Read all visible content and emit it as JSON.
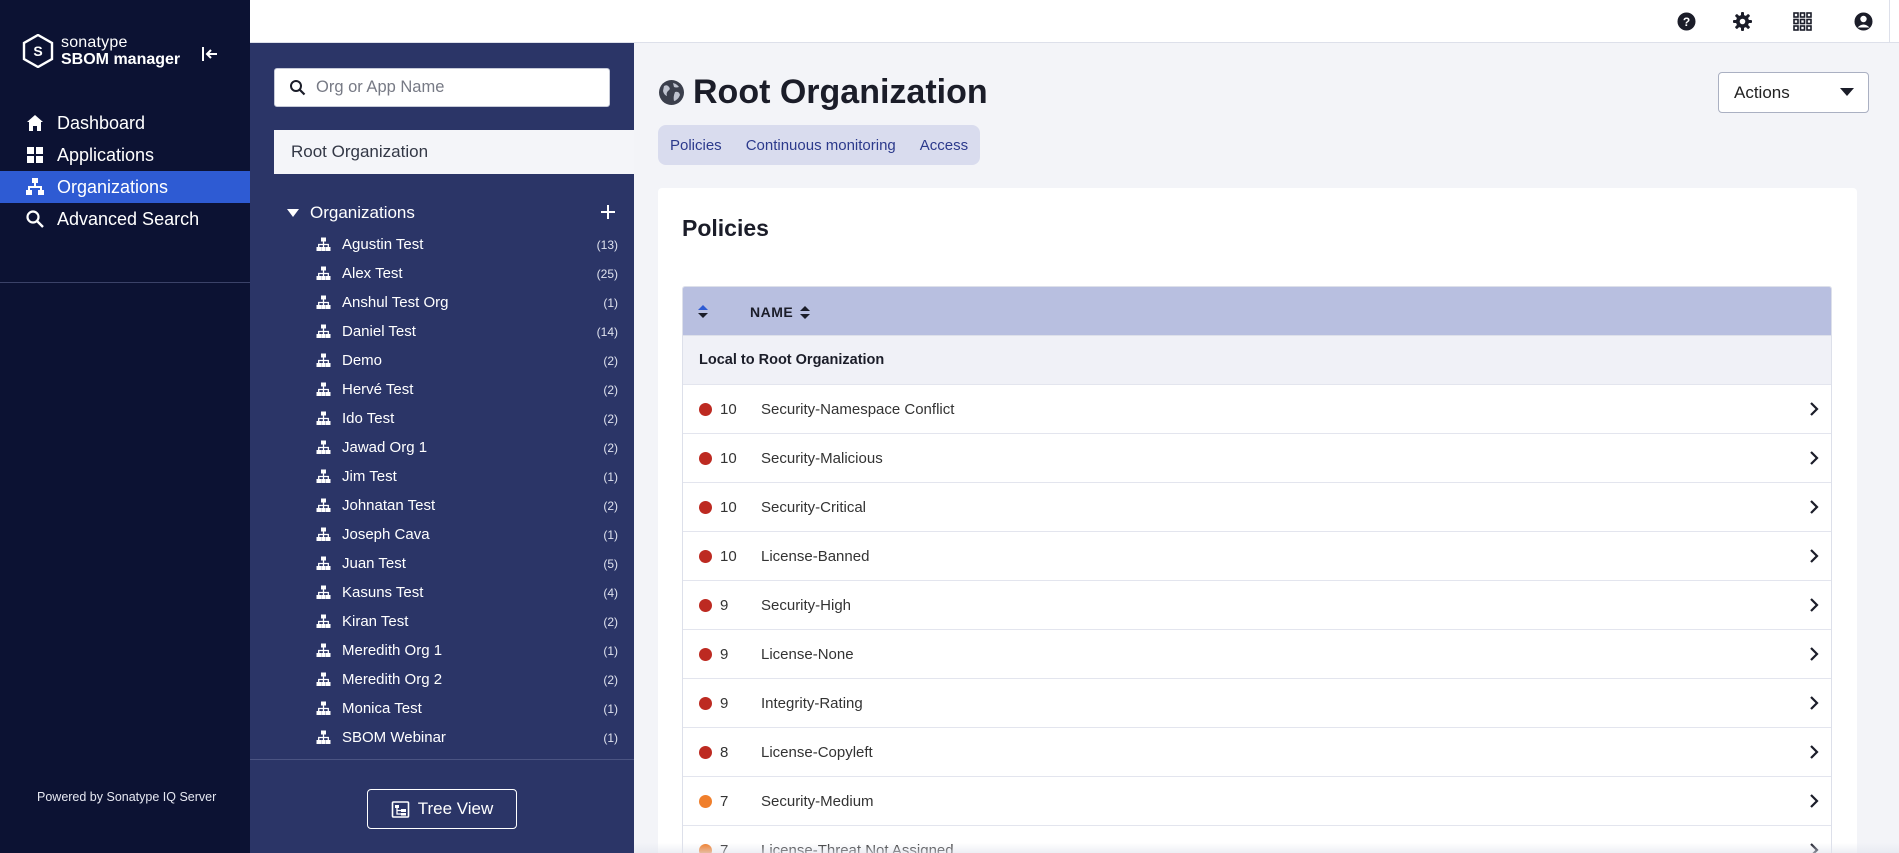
{
  "brand": {
    "line1": "sonatype",
    "line2": "SBOM manager"
  },
  "nav": {
    "items": [
      {
        "label": "Dashboard",
        "icon": "home-icon"
      },
      {
        "label": "Applications",
        "icon": "grid-icon"
      },
      {
        "label": "Organizations",
        "icon": "org-tree-icon",
        "active": true
      },
      {
        "label": "Advanced Search",
        "icon": "search-icon"
      }
    ],
    "powered_by": "Powered by Sonatype IQ Server"
  },
  "topbar": {
    "icons": [
      "help-icon",
      "gear-icon",
      "apps-grid-icon",
      "user-icon"
    ]
  },
  "orgpanel": {
    "search_placeholder": "Org or App Name",
    "root_label": "Root Organization",
    "section_label": "Organizations",
    "orgs": [
      {
        "name": "Agustin Test",
        "count": "(13)"
      },
      {
        "name": "Alex Test",
        "count": "(25)"
      },
      {
        "name": "Anshul Test Org",
        "count": "(1)"
      },
      {
        "name": "Daniel Test",
        "count": "(14)"
      },
      {
        "name": "Demo",
        "count": "(2)"
      },
      {
        "name": "Hervé Test",
        "count": "(2)"
      },
      {
        "name": "Ido Test",
        "count": "(2)"
      },
      {
        "name": "Jawad Org 1",
        "count": "(2)"
      },
      {
        "name": "Jim Test",
        "count": "(1)"
      },
      {
        "name": "Johnatan Test",
        "count": "(2)"
      },
      {
        "name": "Joseph Cava",
        "count": "(1)"
      },
      {
        "name": "Juan Test",
        "count": "(5)"
      },
      {
        "name": "Kasuns Test",
        "count": "(4)"
      },
      {
        "name": "Kiran Test",
        "count": "(2)"
      },
      {
        "name": "Meredith Org 1",
        "count": "(1)"
      },
      {
        "name": "Meredith Org 2",
        "count": "(2)"
      },
      {
        "name": "Monica Test",
        "count": "(1)"
      },
      {
        "name": "SBOM Webinar",
        "count": "(1)"
      }
    ],
    "tree_view_label": "Tree View"
  },
  "main": {
    "title": "Root Organization",
    "actions_label": "Actions",
    "tabs": [
      "Policies",
      "Continuous monitoring",
      "Access"
    ],
    "card_title": "Policies",
    "table": {
      "name_header": "NAME",
      "group_label": "Local to Root Organization",
      "rows": [
        {
          "threat": "10",
          "name": "Security-Namespace Conflict",
          "color": "#bd2a21"
        },
        {
          "threat": "10",
          "name": "Security-Malicious",
          "color": "#bd2a21"
        },
        {
          "threat": "10",
          "name": "Security-Critical",
          "color": "#bd2a21"
        },
        {
          "threat": "10",
          "name": "License-Banned",
          "color": "#bd2a21"
        },
        {
          "threat": "9",
          "name": "Security-High",
          "color": "#bd2a21"
        },
        {
          "threat": "9",
          "name": "License-None",
          "color": "#bd2a21"
        },
        {
          "threat": "9",
          "name": "Integrity-Rating",
          "color": "#bd2a21"
        },
        {
          "threat": "8",
          "name": "License-Copyleft",
          "color": "#bd2a21"
        },
        {
          "threat": "7",
          "name": "Security-Medium",
          "color": "#f07f2c"
        },
        {
          "threat": "7",
          "name": "License-Threat Not Assigned",
          "color": "#f07f2c"
        }
      ]
    }
  },
  "colors": {
    "nav_bg": "#0c1233",
    "panel_bg": "#2b3567",
    "active": "#2e5bd3",
    "critical": "#bd2a21",
    "severe": "#f07f2c"
  }
}
